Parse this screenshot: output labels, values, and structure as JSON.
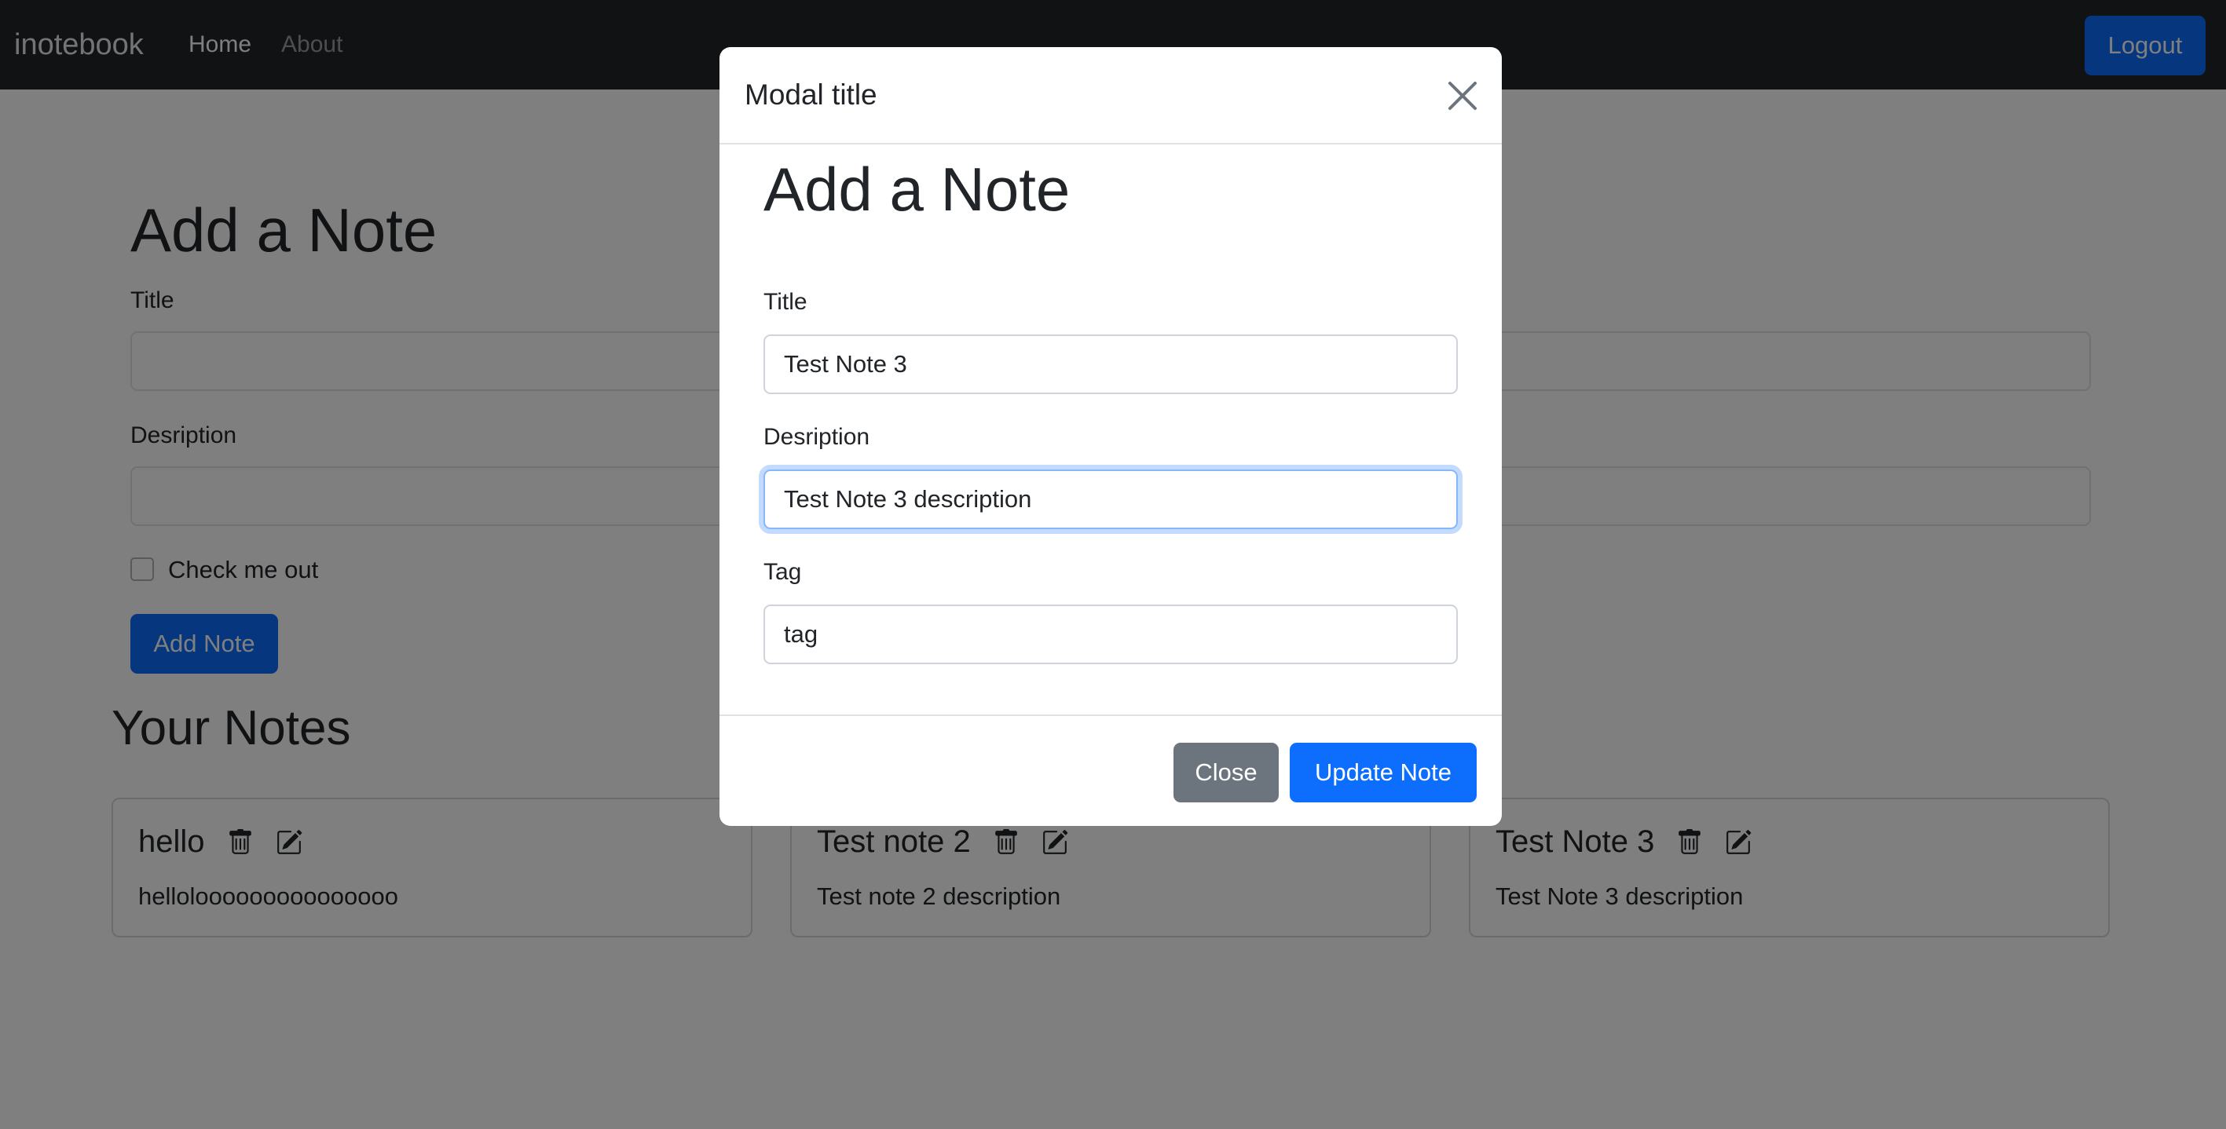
{
  "navbar": {
    "brand": "inotebook",
    "links": [
      "Home",
      "About"
    ],
    "logout_label": "Logout"
  },
  "page": {
    "heading": "Add a Note",
    "title_label": "Title",
    "description_label": "Desription",
    "checkbox_label": "Check me out",
    "add_button": "Add Note",
    "notes_heading": "Your Notes",
    "notes": [
      {
        "title": "hello",
        "description": "hellolooooooooooooooo"
      },
      {
        "title": "Test note 2",
        "description": "Test note 2 description"
      },
      {
        "title": "Test Note 3",
        "description": "Test Note 3 description"
      }
    ]
  },
  "modal": {
    "title": "Modal title",
    "heading": "Add a Note",
    "title_label": "Title",
    "title_value": "Test Note 3",
    "description_label": "Desription",
    "description_value": "Test Note 3 description",
    "tag_label": "Tag",
    "tag_value": "tag",
    "close_button": "Close",
    "update_button": "Update Note"
  },
  "icons": {
    "close": "close-icon",
    "delete": "trash-icon",
    "edit": "edit-icon"
  },
  "colors": {
    "primary": "#0d6efd",
    "secondary": "#6c757d",
    "navbar": "#212529"
  }
}
